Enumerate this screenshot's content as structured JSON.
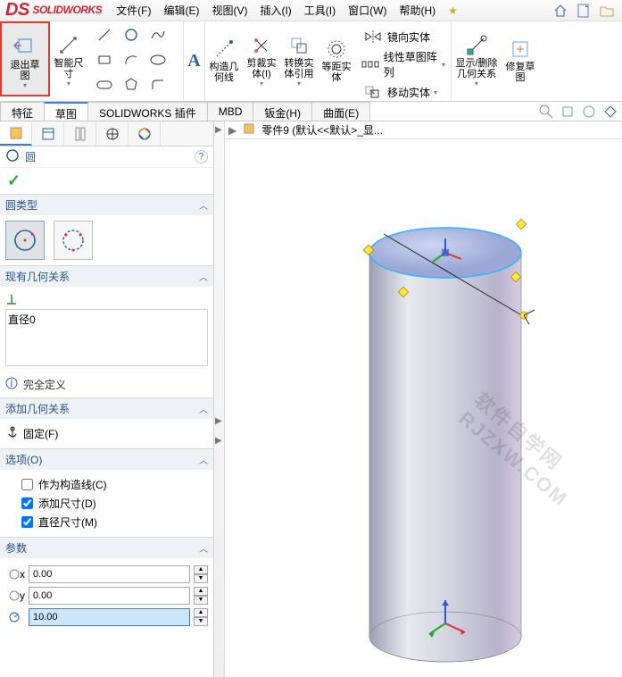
{
  "app": {
    "name": "SOLIDWORKS"
  },
  "menu": {
    "file": "文件(F)",
    "edit": "编辑(E)",
    "view": "视图(V)",
    "insert": "插入(I)",
    "tools": "工具(I)",
    "window": "窗口(W)",
    "help": "帮助(H)",
    "star": "★"
  },
  "ribbon": {
    "exit_sketch": "退出草\n图",
    "smart_dim": "智能尺\n寸",
    "construction": "构造几\n何线",
    "trim": "剪裁实\n体(I)",
    "convert": "转换实\n体引用",
    "offset": "等距实\n体",
    "mirror": "镜向实体",
    "linear_pattern": "线性草图阵列",
    "move": "移动实体",
    "show_rel": "显示/删除\n几何关系",
    "repair": "修复草\n图"
  },
  "tabs": {
    "features": "特征",
    "sketch": "草图",
    "plugins": "SOLIDWORKS 插件",
    "mbd": "MBD",
    "sheetmetal": "钣金(H)",
    "surface": "曲面(E)"
  },
  "doc": {
    "crumb": "▶",
    "name": "零件9 (默认<<默认>_显..."
  },
  "pm": {
    "title": "圆",
    "help": "?",
    "sec_type": "圆类型",
    "sec_existing": "现有几何关系",
    "rel0": "直径0",
    "fully_defined": "完全定义",
    "sec_addrel": "添加几何关系",
    "fix": "固定(F)",
    "sec_options": "选项(O)",
    "opt_construction": "作为构造线(C)",
    "opt_adddim": "添加尺寸(D)",
    "opt_diamdim": "直径尺寸(M)",
    "sec_params": "参数",
    "cx": "0.00",
    "cy": "0.00",
    "r": "10.00"
  },
  "watermark": "软件自学网 RJZXW.COM"
}
